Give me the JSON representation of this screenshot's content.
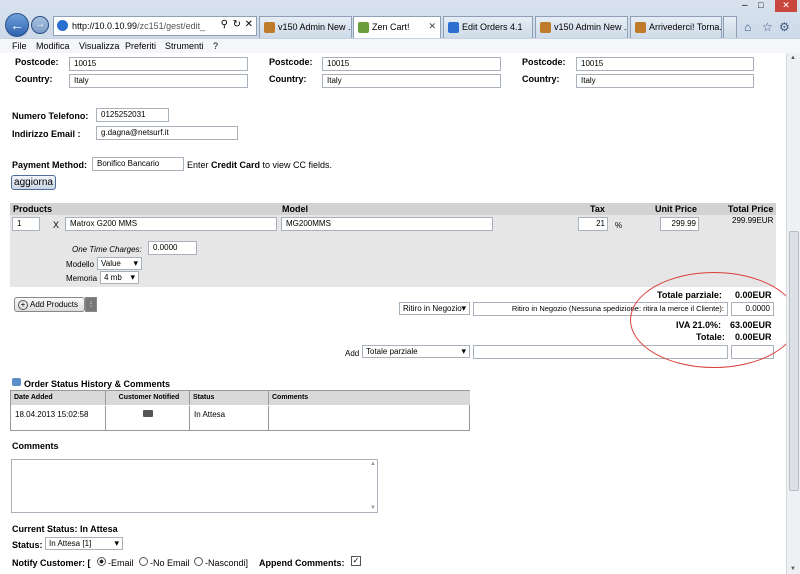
{
  "browser": {
    "address_host": "http://10.0.10.99",
    "address_path": "/zc151/gest/edit_",
    "tabs": [
      {
        "label": "v150 Admin New ...",
        "icon_color": "#c07b2a"
      },
      {
        "label": "Zen Cart!",
        "icon_color": "#6a9e3a",
        "active": true
      },
      {
        "label": "Edit Orders 4.1",
        "icon_color": "#2c6fcf"
      },
      {
        "label": "v150 Admin New ...",
        "icon_color": "#c07b2a"
      },
      {
        "label": "Arrivederci! Torna...",
        "icon_color": "#c07b2a"
      }
    ],
    "menu": [
      "File",
      "Modifica",
      "Visualizza",
      "Preferiti",
      "Strumenti",
      "?"
    ]
  },
  "address": {
    "postcode_label": "Postcode:",
    "country_label": "Country:",
    "postcode_values": [
      "10015",
      "10015",
      "10015"
    ],
    "country_values": [
      "Italy",
      "Italy",
      "Italy"
    ]
  },
  "contact": {
    "phone_label": "Numero Telefono:",
    "phone": "0125252031",
    "email_label": "Indirizzo Email :",
    "email": "g.dagna@netsurf.it"
  },
  "payment": {
    "label": "Payment Method:",
    "value": "Bonifico Bancario",
    "hint_pre": "Enter ",
    "hint_bold": "Credit Card",
    "hint_post": " to view CC fields.",
    "update_button": "aggiorna"
  },
  "products": {
    "headers": {
      "products": "Products",
      "model": "Model",
      "tax": "Tax",
      "unit_price": "Unit Price",
      "total_price": "Total Price"
    },
    "row": {
      "qty": "1",
      "x": "X",
      "name": "Matrox G200 MMS",
      "model": "MG200MMS",
      "tax": "21",
      "pct": "%",
      "unit_price": "299.99",
      "total": "299.99EUR"
    },
    "one_time_label": "One Time Charges:",
    "one_time_value": "0.0000",
    "attrs": [
      {
        "label": "Modello",
        "value": "Value"
      },
      {
        "label": "Memoria",
        "value": "4 mb"
      }
    ]
  },
  "add_products_button": "Add Products",
  "totals": {
    "subtotal_label": "Totale parziale:",
    "subtotal_value": "0.00EUR",
    "shipping_select": "Ritiro in Negozio",
    "shipping_desc": "Ritiro in Negozio (Nessuna spedizione: ritira la merce il Cliente):",
    "shipping_value": "0.0000",
    "iva_label": "IVA 21.0%:",
    "iva_value": "63.00EUR",
    "total_label": "Totale:",
    "total_value": "0.00EUR",
    "add_label": "Add",
    "add_select": "Totale parziale"
  },
  "history": {
    "title": "Order Status History & Comments",
    "headers": [
      "Date Added",
      "Customer Notified",
      "Status",
      "Comments"
    ],
    "row": {
      "date": "18.04.2013 15:02:58",
      "status": "In Attesa",
      "comments": ""
    }
  },
  "comments_label": "Comments",
  "current_status": "Current Status: In Attesa",
  "status_label": "Status:",
  "status_value": "In Attesa [1]",
  "notify": {
    "label": "Notify Customer: [",
    "email": "-Email",
    "noemail": "-No Email",
    "hide": "-Nascondi]",
    "append": "Append Comments:"
  }
}
